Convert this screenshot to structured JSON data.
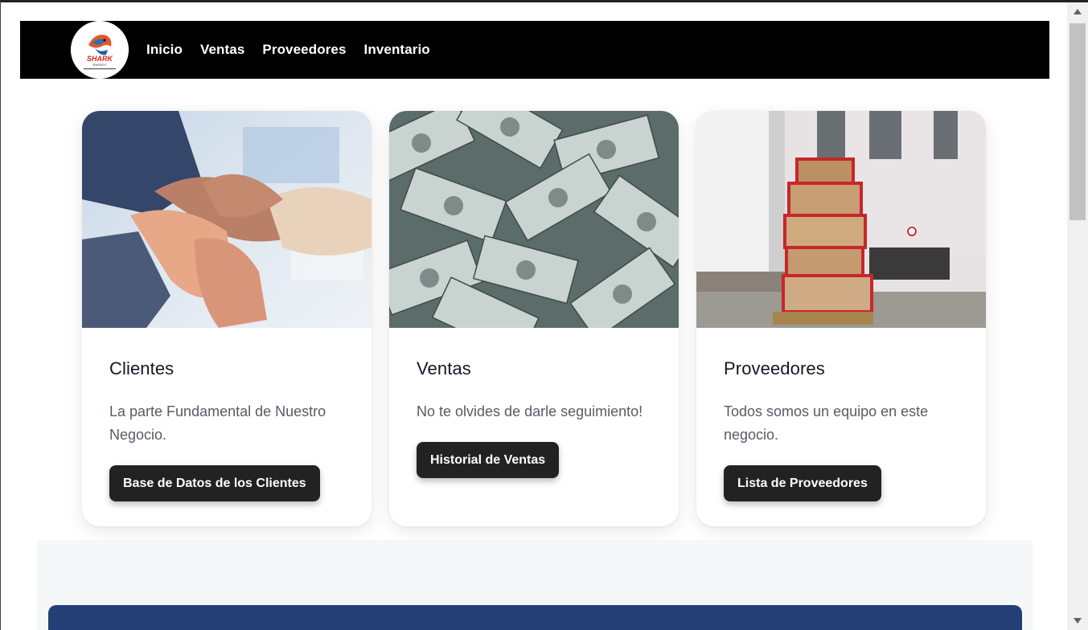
{
  "nav": {
    "logo_text": "SHARK",
    "links": [
      "Inicio",
      "Ventas",
      "Proveedores",
      "Inventario"
    ]
  },
  "cards": [
    {
      "title": "Clientes",
      "text": "La parte Fundamental de Nuestro Negocio.",
      "button": "Base de Datos de los Clientes",
      "image": "hands-teamwork-image"
    },
    {
      "title": "Ventas",
      "text": "No te olvides de darle seguimiento!",
      "button": "Historial de Ventas",
      "image": "dollar-bills-image"
    },
    {
      "title": "Proveedores",
      "text": "Todos somos un equipo en este negocio.",
      "button": "Lista de Proveedores",
      "image": "delivery-boxes-image"
    }
  ],
  "colors": {
    "navbar": "#000000",
    "button": "#222222",
    "banner": "#233f76",
    "section_bg": "#f6f7f9"
  }
}
